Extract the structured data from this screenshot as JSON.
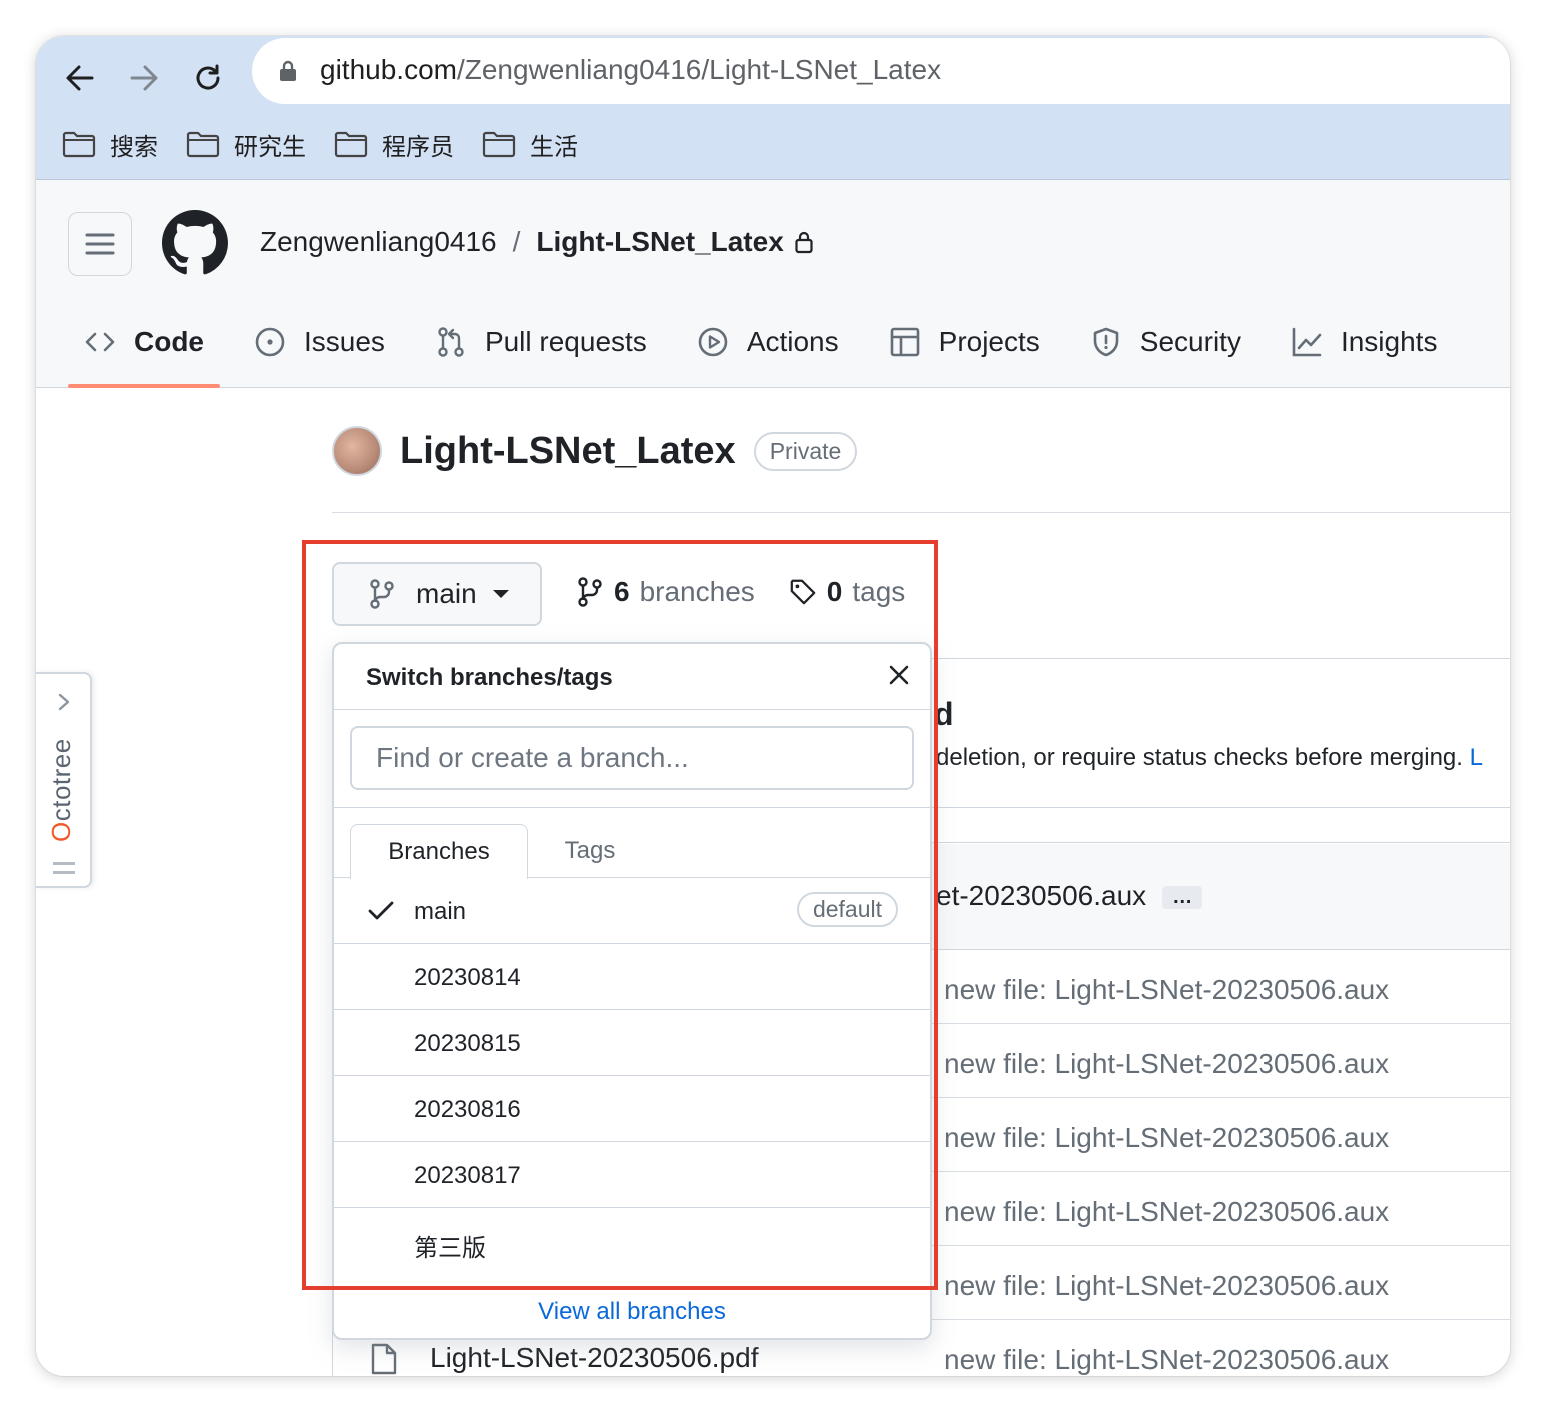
{
  "browser": {
    "url_domain": "github.com",
    "url_path": "/Zengwenliang0416/Light-LSNet_Latex",
    "bookmarks": [
      "搜索",
      "研究生",
      "程序员",
      "生活"
    ]
  },
  "header": {
    "owner": "Zengwenliang0416",
    "separator": "/",
    "repo": "Light-LSNet_Latex",
    "tabs": [
      {
        "label": "Code",
        "icon": "code-icon",
        "active": true
      },
      {
        "label": "Issues",
        "icon": "issue-icon"
      },
      {
        "label": "Pull requests",
        "icon": "pull-request-icon"
      },
      {
        "label": "Actions",
        "icon": "play-icon"
      },
      {
        "label": "Projects",
        "icon": "table-icon"
      },
      {
        "label": "Security",
        "icon": "shield-icon"
      },
      {
        "label": "Insights",
        "icon": "graph-icon"
      }
    ]
  },
  "repo": {
    "name": "Light-LSNet_Latex",
    "visibility": "Private",
    "current_branch": "main",
    "branch_count": "6",
    "branch_word": "branches",
    "tag_count": "0",
    "tag_word": "tags"
  },
  "dropdown": {
    "title": "Switch branches/tags",
    "search_placeholder": "Find or create a branch...",
    "tab_branches": "Branches",
    "tab_tags": "Tags",
    "branches": [
      {
        "name": "main",
        "selected": true,
        "badge": "default"
      },
      {
        "name": "20230814"
      },
      {
        "name": "20230815"
      },
      {
        "name": "20230816"
      },
      {
        "name": "20230817"
      },
      {
        "name": "第三版"
      }
    ],
    "footer_link": "View all branches"
  },
  "background": {
    "heading_fragment": "d",
    "protect_msg": "deletion, or require status checks before merging.",
    "protect_link": "L",
    "latest_commit": "et-20230506.aux",
    "commit_dots": "…",
    "row_messages": [
      "new file: Light-LSNet-20230506.aux",
      "new file: Light-LSNet-20230506.aux",
      "new file: Light-LSNet-20230506.aux",
      "new file: Light-LSNet-20230506.aux",
      "new file: Light-LSNet-20230506.aux",
      "new file: Light-LSNet-20230506.aux"
    ],
    "visible_file": "Light-LSNet-20230506.pdf"
  },
  "octotree": {
    "label_first": "O",
    "label_rest": "ctotree"
  },
  "colors": {
    "highlight": "#e53d2e",
    "accent_link": "#0969da",
    "tab_underline": "#fd8c73",
    "chrome": "#d3e1f5"
  }
}
